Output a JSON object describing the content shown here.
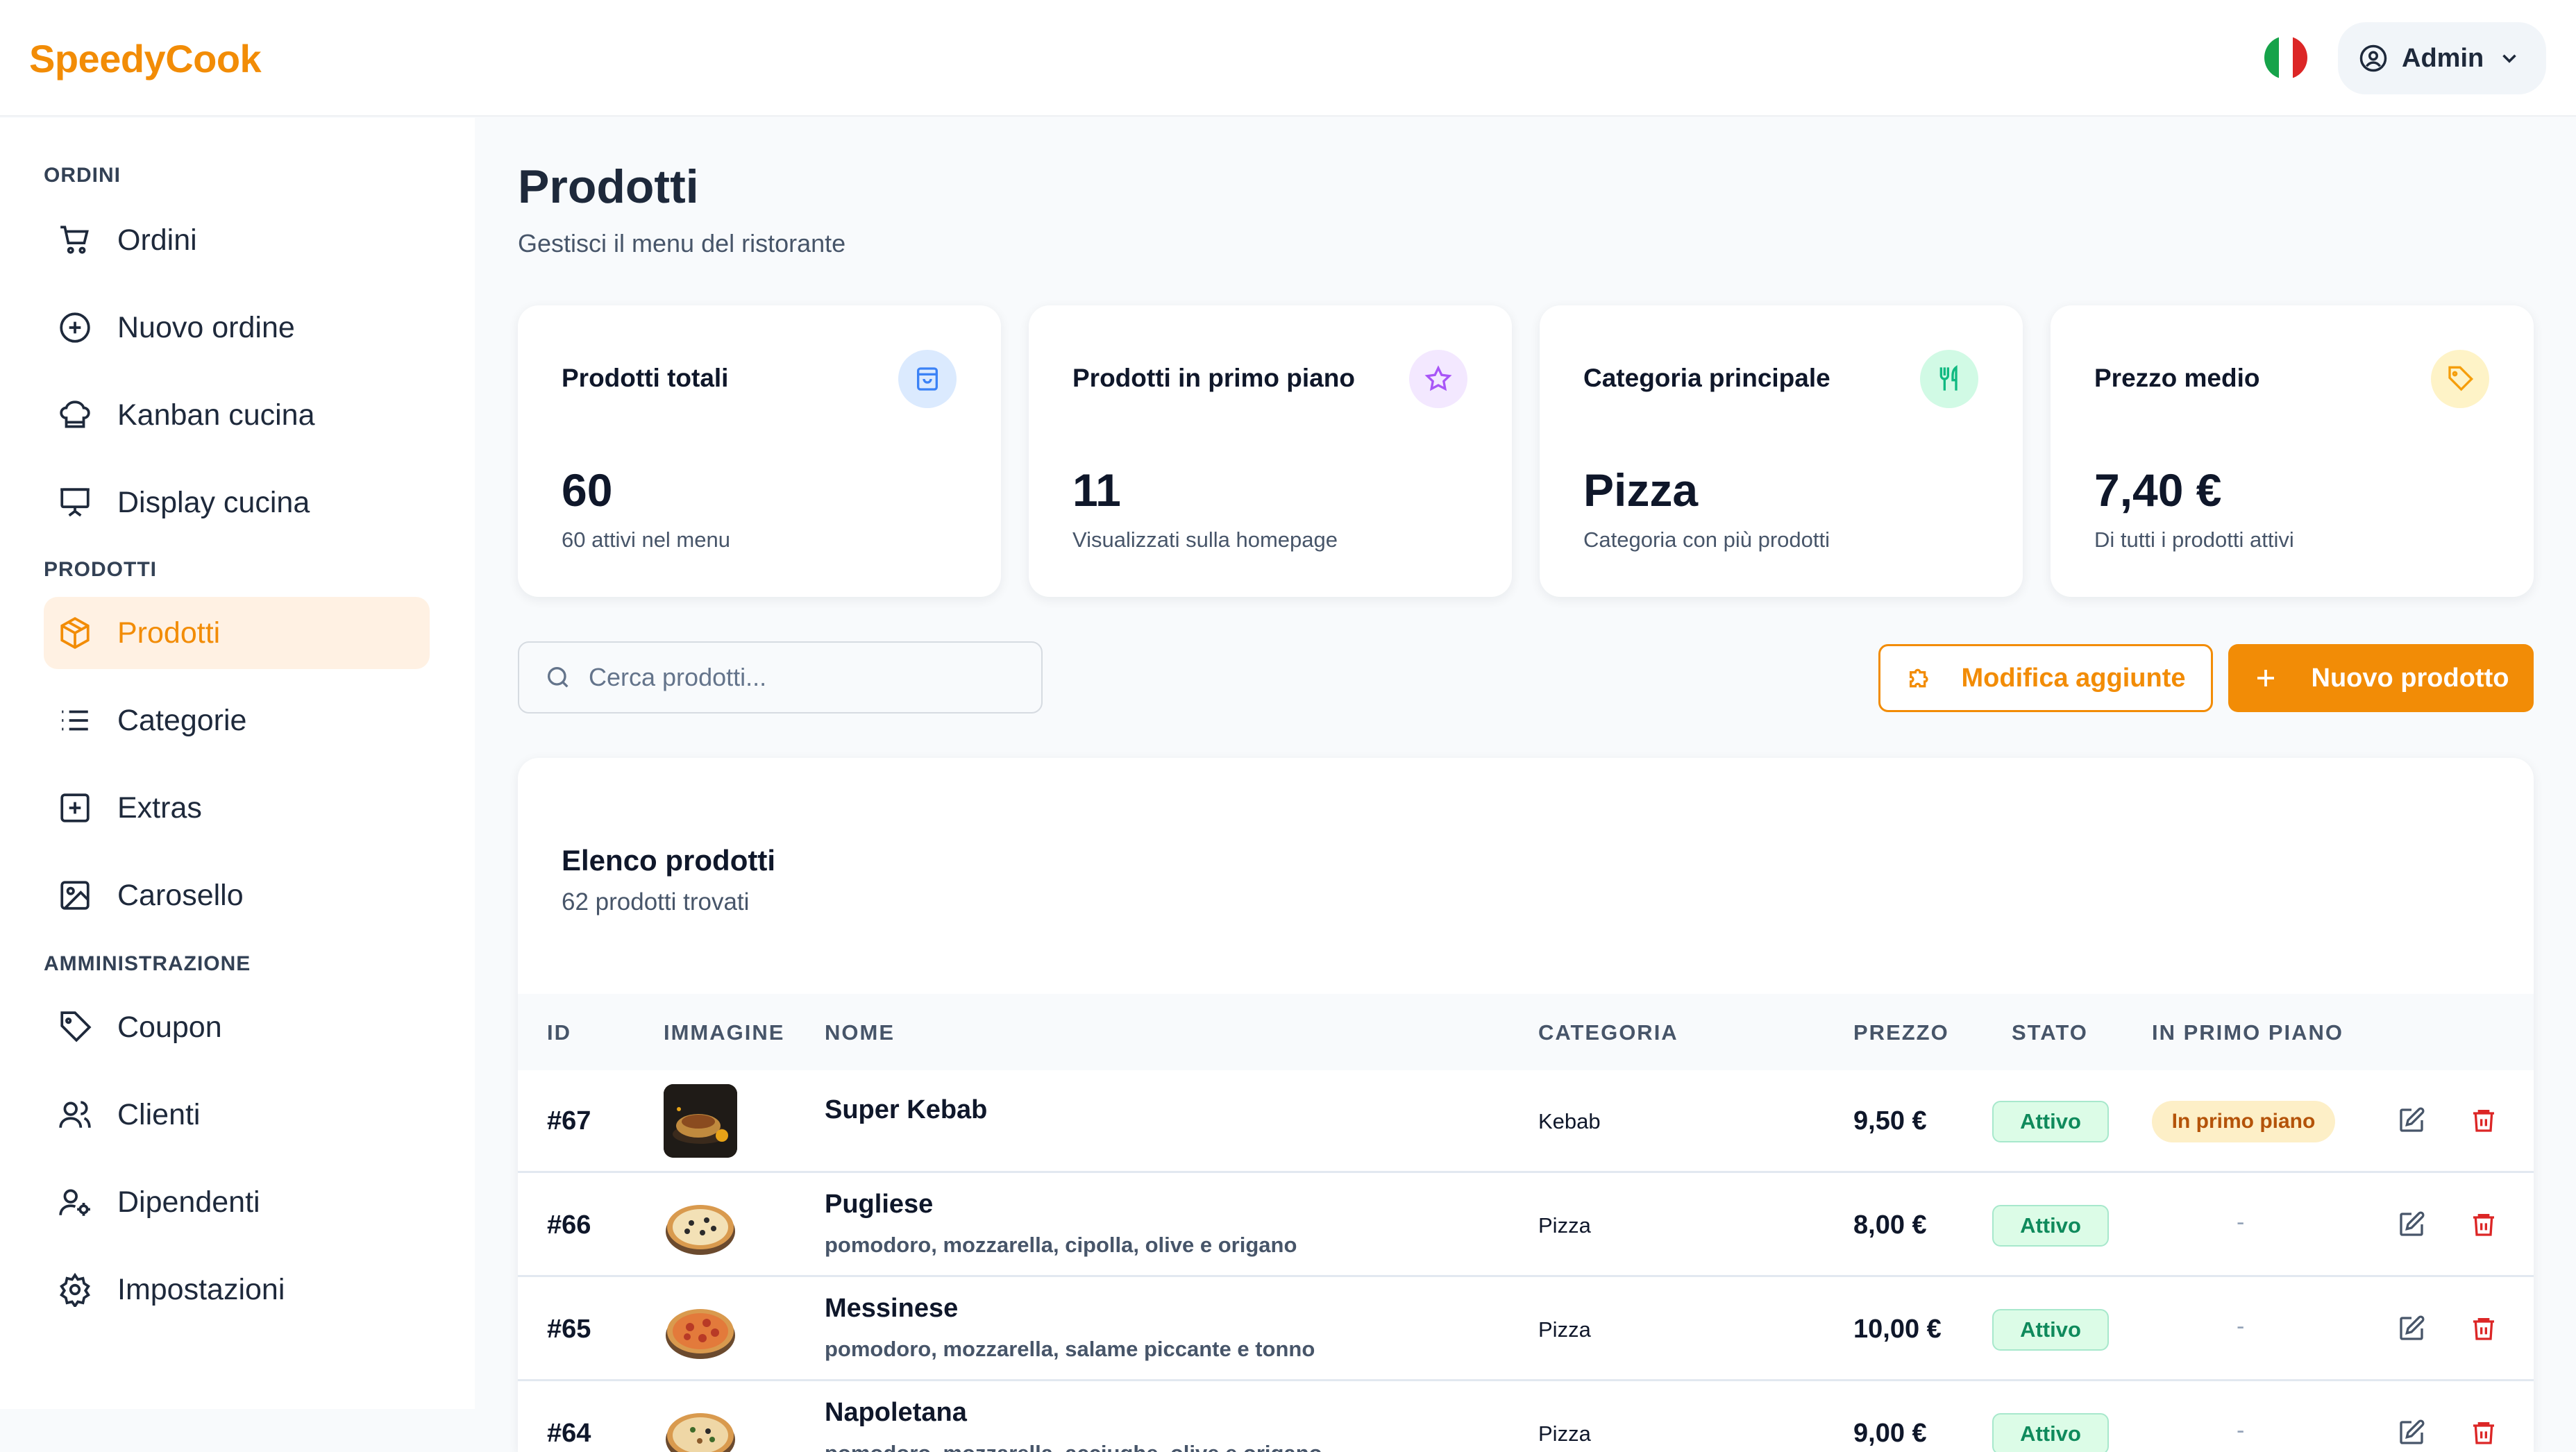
{
  "app": {
    "name": "SpeedyCook"
  },
  "header": {
    "user_label": "Admin",
    "language_flag": "italy-flag"
  },
  "sidebar": {
    "sections": [
      {
        "title": "ORDINI",
        "items": [
          {
            "label": "Ordini",
            "icon": "cart-icon"
          },
          {
            "label": "Nuovo ordine",
            "icon": "plus-circle-icon"
          },
          {
            "label": "Kanban cucina",
            "icon": "chef-hat-icon"
          },
          {
            "label": "Display cucina",
            "icon": "presentation-icon"
          }
        ]
      },
      {
        "title": "PRODOTTI",
        "items": [
          {
            "label": "Prodotti",
            "icon": "box-icon",
            "active": true
          },
          {
            "label": "Categorie",
            "icon": "list-icon"
          },
          {
            "label": "Extras",
            "icon": "plus-square-icon"
          },
          {
            "label": "Carosello",
            "icon": "image-icon"
          }
        ]
      },
      {
        "title": "AMMINISTRAZIONE",
        "items": [
          {
            "label": "Coupon",
            "icon": "tag-icon"
          },
          {
            "label": "Clienti",
            "icon": "users-icon"
          },
          {
            "label": "Dipendenti",
            "icon": "user-cog-icon"
          },
          {
            "label": "Impostazioni",
            "icon": "gear-icon"
          }
        ]
      }
    ]
  },
  "page": {
    "title": "Prodotti",
    "subtitle": "Gestisci il menu del ristorante"
  },
  "stats": [
    {
      "title": "Prodotti totali",
      "value": "60",
      "desc": "60 attivi nel menu",
      "icon": "shopping-bag-icon",
      "color": "#3b82f6"
    },
    {
      "title": "Prodotti in primo piano",
      "value": "11",
      "desc": "Visualizzati sulla homepage",
      "icon": "star-icon",
      "color": "#a855f7"
    },
    {
      "title": "Categoria principale",
      "value": "Pizza",
      "desc": "Categoria con più prodotti",
      "icon": "utensils-icon",
      "color": "#10b981"
    },
    {
      "title": "Prezzo medio",
      "value": "7,40 €",
      "desc": "Di tutti i prodotti attivi",
      "icon": "tag-icon",
      "color": "#f59e0b"
    }
  ],
  "toolbar": {
    "search_placeholder": "Cerca prodotti...",
    "edit_addons_label": "Modifica aggiunte",
    "new_product_label": "Nuovo prodotto"
  },
  "list": {
    "title": "Elenco prodotti",
    "count_text": "62 prodotti trovati",
    "columns": [
      "ID",
      "IMMAGINE",
      "NOME",
      "CATEGORIA",
      "PREZZO",
      "STATO",
      "IN PRIMO PIANO"
    ],
    "rows": [
      {
        "id": "#67",
        "name": "Super Kebab",
        "desc": "",
        "category": "Kebab",
        "price": "9,50 €",
        "status": "Attivo",
        "featured": "In primo piano",
        "image": "kebab"
      },
      {
        "id": "#66",
        "name": "Pugliese",
        "desc": "pomodoro, mozzarella, cipolla, olive e origano",
        "category": "Pizza",
        "price": "8,00 €",
        "status": "Attivo",
        "featured": "-",
        "image": "pizza"
      },
      {
        "id": "#65",
        "name": "Messinese",
        "desc": "pomodoro, mozzarella, salame piccante e tonno",
        "category": "Pizza",
        "price": "10,00 €",
        "status": "Attivo",
        "featured": "-",
        "image": "pizza"
      },
      {
        "id": "#64",
        "name": "Napoletana",
        "desc": "pomodoro, mozzarella, acciughe, olive e origano",
        "category": "Pizza",
        "price": "9,00 €",
        "status": "Attivo",
        "featured": "-",
        "image": "pizza"
      }
    ]
  },
  "colors": {
    "accent": "#f28c06",
    "active_bg": "#fff1e3",
    "danger": "#dc2626",
    "success": "#0f8a5c"
  }
}
